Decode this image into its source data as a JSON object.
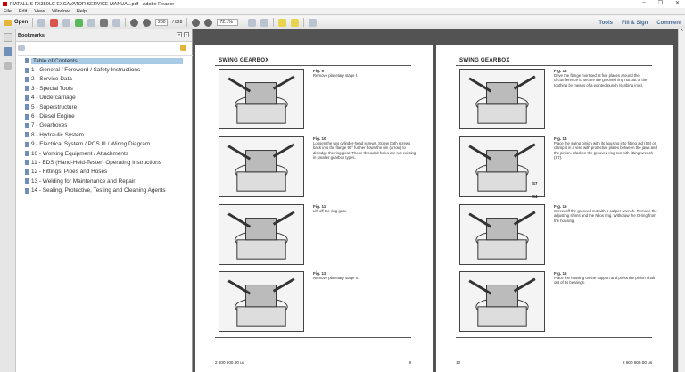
{
  "window": {
    "title": "FIATALLIS FX350LC EXCAVATOR SERVICE MANUAL.pdf - Adobe Reader",
    "minimize": "–",
    "restore": "❐",
    "close": "✕"
  },
  "menu": [
    "File",
    "Edit",
    "View",
    "Window",
    "Help"
  ],
  "toolbar": {
    "open_label": "Open",
    "current_page": "230",
    "total_pages": "/ 828",
    "zoom": "72.1%",
    "tools": "Tools",
    "fill_sign": "Fill & Sign",
    "comment": "Comment"
  },
  "bookmarks": {
    "title": "Bookmarks",
    "items": [
      "Table of Contents",
      "1 - General / Foreword / Safety Instructions",
      "2 - Service Data",
      "3 - Special Tools",
      "4 - Undercarriage",
      "5 - Superstructure",
      "6 - Diesel Engine",
      "7 - Gearboxes",
      "8 - Hydraulic System",
      "9 - Electrical System / PCS III / Wiring Diagram",
      "10 - Working Equipment / Attachments",
      "11 - EDS (Hand-Held-Tester) Operating Instructions",
      "12 - Fittings, Pipes and Hoses",
      "13 - Welding for Maintenance and Repair",
      "14 - Sealing, Protective, Testing and Cleaning Agents"
    ]
  },
  "left_page": {
    "heading": "SWING GEARBOX",
    "figs": [
      {
        "label": "Fig. 9",
        "text": "Remove planetary stage I."
      },
      {
        "label": "Fig. 10",
        "text": "Loosen the two cylinder-head screws. Screw both screws back into the flange 90° further down the rim (arrow) to dislodge the ring gear. These threaded holes are not existing in smaller gearbox types."
      },
      {
        "label": "Fig. 11",
        "text": "Lift off the ring gear."
      },
      {
        "label": "Fig. 12",
        "text": "Remove planetary stage II."
      }
    ],
    "doc_number": "2 600 600.00 us",
    "page_number": "9"
  },
  "right_page": {
    "heading": "SWING GEARBOX",
    "figs": [
      {
        "label": "Fig. 13",
        "text": "Drive the flange mortised at five places around the circumference to secure the grooved ring nut out of the toothing by means of a pointed punch (scribing iron)."
      },
      {
        "label": "Fig. 14",
        "text": "Place the swing pinion with its housing into fitting aid (S4) or clamp it in a vise with protective plates between the jaws and the pinion. Slacken the grooved ring nut with fitting wrench (S7)."
      },
      {
        "label": "Fig. 15",
        "text": "Screw off the grooved nut with a caliper wrench. Remove the adjusting shims and the Nilos ring. Withdraw the O-ring from the housing."
      },
      {
        "label": "Fig. 16",
        "text": "Place the housing on the support and press the pinion shaft out of its bearings."
      }
    ],
    "callouts": [
      "S7",
      "S4"
    ],
    "doc_number": "2 600 600.00 us",
    "page_number": "10"
  }
}
